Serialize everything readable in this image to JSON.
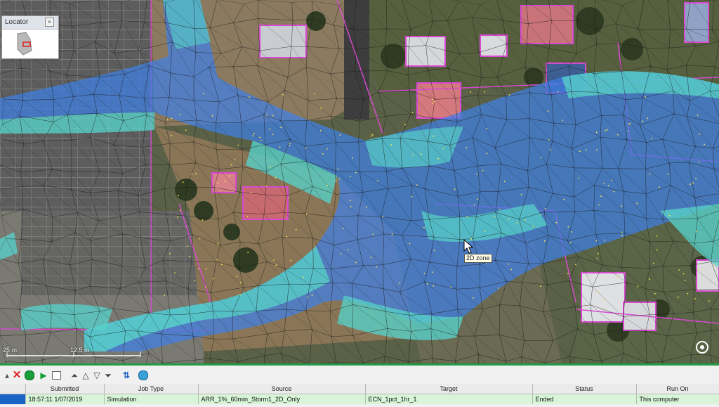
{
  "locator": {
    "title": "Locator"
  },
  "map": {
    "tooltip": "2D zone",
    "scale_labels": [
      "25 m",
      "12.5 m"
    ],
    "colors": {
      "flood_deep": "#3f7fe6",
      "flood_shallow": "#57d0c8",
      "mesh": "#1b1b1b",
      "boundary": "#d84ad0"
    }
  },
  "toolbar": {
    "icons": [
      "close-icon",
      "record-icon",
      "play-icon",
      "chart-icon",
      "move-top-icon",
      "move-up-icon",
      "move-down-icon",
      "move-bottom-icon",
      "refresh-icon",
      "globe-icon"
    ]
  },
  "jobs": {
    "columns": [
      "",
      "Submitted",
      "Job Type",
      "Source",
      "Target",
      "Status",
      "Run On"
    ],
    "rows": [
      {
        "submitted": "18:57:11 1/07/2019",
        "job_type": "Simulation",
        "source": "ARR_1%_60min_Storm1_2D_Only",
        "target": "ECN_1pct_1hr_1",
        "status": "Ended",
        "run_on": "This computer"
      }
    ]
  },
  "panel_accent": "#1f9a45"
}
